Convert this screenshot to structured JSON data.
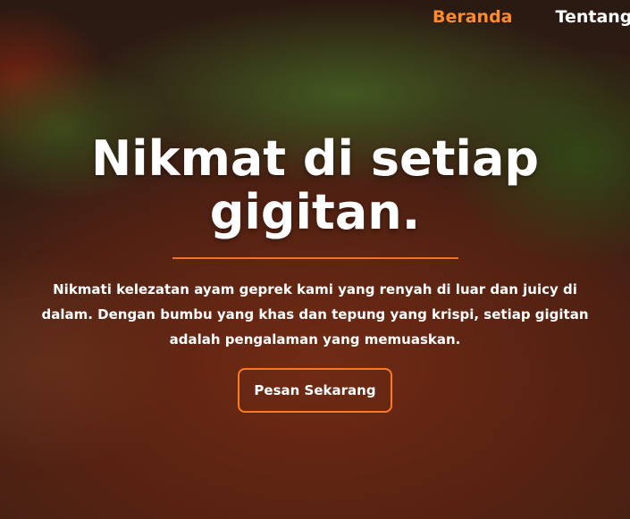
{
  "nav": {
    "items": [
      {
        "label": "Beranda",
        "active": true
      },
      {
        "label": "Tentang",
        "active": false
      }
    ]
  },
  "hero": {
    "title": "Nikmat di setiap gigitan.",
    "description": "Nikmati kelezatan ayam geprek kami yang renyah di luar dan juicy di dalam. Dengan bumbu yang khas dan tepung yang krispi, setiap gigitan adalah pengalaman yang memuaskan.",
    "cta_label": "Pesan Sekarang"
  },
  "colors": {
    "accent": "#ff7a1f",
    "active_nav": "#ff8a2b",
    "text": "#ffffff"
  }
}
